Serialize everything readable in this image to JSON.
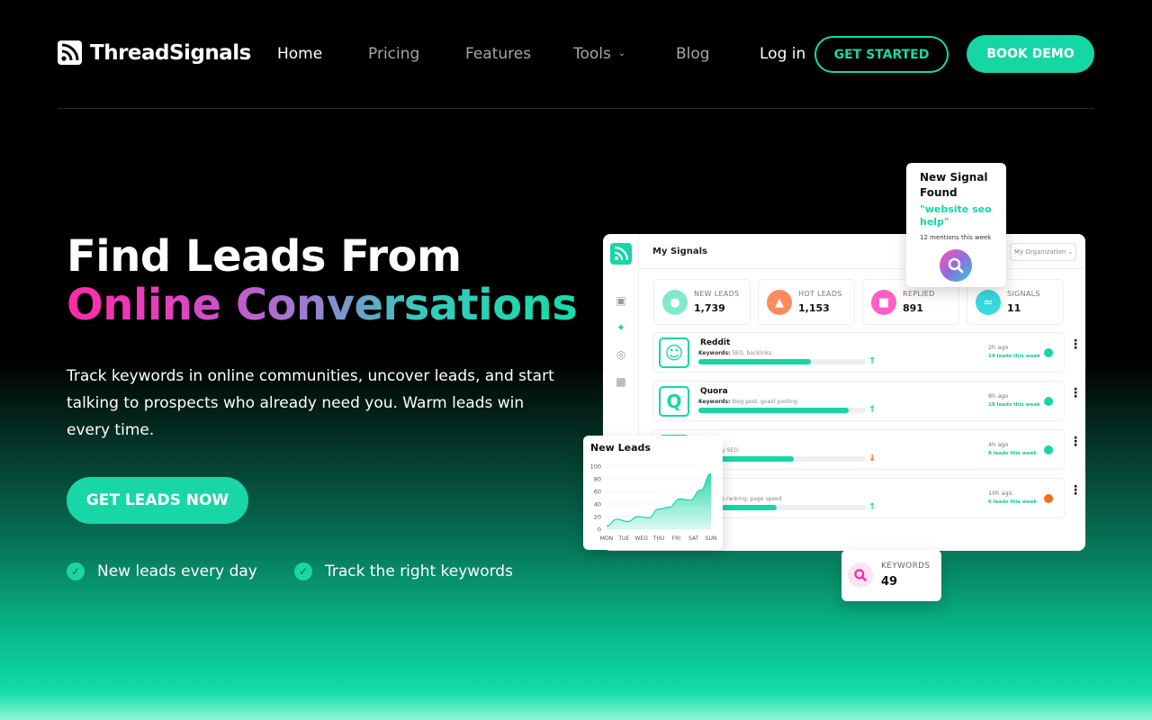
{
  "brand": {
    "name": "ThreadSignals"
  },
  "nav": {
    "links": [
      "Home",
      "Pricing",
      "Features",
      "Tools",
      "Blog"
    ],
    "login": "Log in",
    "get_started": "GET STARTED",
    "book_demo": "BOOK DEMO"
  },
  "hero": {
    "title_line1": "Find Leads From",
    "title_line2": "Online Conversations",
    "description": "Track keywords in online communities, uncover leads, and start talking to prospects who already need you. Warm leads win every time.",
    "cta": "GET LEADS NOW",
    "checks": [
      "New leads every day",
      "Track the right keywords"
    ]
  },
  "dashboard": {
    "title": "My Signals",
    "org_select": "My Organization",
    "stats": [
      {
        "label": "NEW LEADS",
        "value": "1,739",
        "color": "#7fe9cb",
        "icon": "user-icon"
      },
      {
        "label": "HOT LEADS",
        "value": "1,153",
        "color": "#ff8a5b",
        "icon": "fire-icon"
      },
      {
        "label": "REPLIED",
        "value": "891",
        "color": "#ff5fc4",
        "icon": "chat-icon"
      },
      {
        "label": "SIGNALS",
        "value": "11",
        "color": "#3ad8e0",
        "icon": "wifi-icon"
      }
    ],
    "rows": [
      {
        "name": "Reddit",
        "kw_label": "Keywords:",
        "keywords": "SEO, backlinks",
        "progress": 0.67,
        "trend": "up",
        "time": "2h ago",
        "week": "14 leads this week",
        "status": "#16d6a5",
        "icon": "reddit-icon"
      },
      {
        "name": "Quora",
        "kw_label": "Keywords:",
        "keywords": "blog post, guest posting",
        "progress": 0.9,
        "trend": "up",
        "time": "8h ago",
        "week": "19 leads this week",
        "status": "#16d6a5",
        "icon": "quora-icon"
      },
      {
        "name": "dIn",
        "kw_label": "s:",
        "keywords": "agency SEO",
        "progress": 0.57,
        "trend": "down",
        "time": "4h ago",
        "week": "9 leads this week",
        "status": "#16d6a5",
        "icon": "linkedin-icon"
      },
      {
        "name": "book",
        "kw_label": "s:",
        "keywords": "Google ranking, page speed",
        "progress": 0.47,
        "trend": "up",
        "time": "10h ago",
        "week": "6 leads this week",
        "status": "#ff6a13",
        "icon": "facebook-icon"
      }
    ]
  },
  "signal_card": {
    "title": "New Signal Found",
    "quote": "\"website seo help\"",
    "mentions": "12 mentions this week"
  },
  "keywords_card": {
    "label": "KEYWORDS",
    "value": "49"
  },
  "chart_data": {
    "type": "area",
    "title": "New Leads",
    "categories": [
      "MON",
      "TUE",
      "WED",
      "THU",
      "FRI",
      "SAT",
      "SUN"
    ],
    "y_ticks": [
      "100",
      "80",
      "60",
      "40",
      "20",
      "0"
    ],
    "values": [
      5,
      16,
      12,
      20,
      18,
      32,
      35,
      48,
      46,
      62,
      88
    ],
    "ylim": [
      0,
      100
    ],
    "xlabel": "",
    "ylabel": "",
    "grid": true
  },
  "colors": {
    "accent": "#16d6a5",
    "pink": "#ff2aa6",
    "orange": "#ff6a13"
  }
}
